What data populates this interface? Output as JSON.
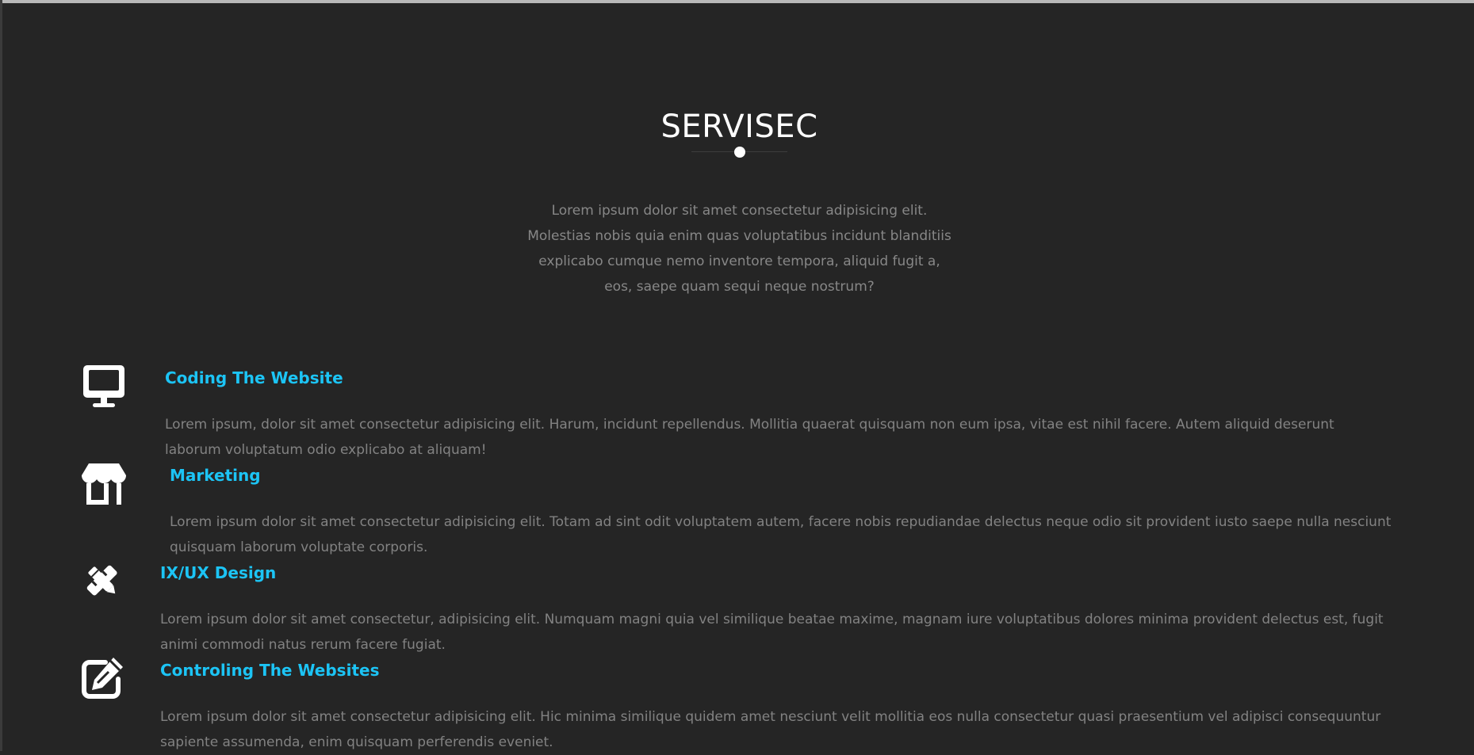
{
  "section": {
    "title": "SERVISEC",
    "intro": "Lorem ipsum dolor sit amet consectetur adipisicing elit. Molestias nobis quia enim quas voluptatibus incidunt blanditiis explicabo cumque nemo inventore tempora, aliquid fugit a, eos, saepe quam sequi neque nostrum?"
  },
  "services": [
    {
      "icon": "desktop-icon",
      "title": "Coding The Website",
      "desc": "Lorem ipsum, dolor sit amet consectetur adipisicing elit. Harum, incidunt repellendus. Mollitia quaerat quisquam non eum ipsa, vitae est nihil facere. Autem aliquid deserunt laborum voluptatum odio explicabo at aliquam!"
    },
    {
      "icon": "shop-icon",
      "title": "Marketing",
      "desc": "Lorem ipsum dolor sit amet consectetur adipisicing elit. Totam ad sint odit voluptatem autem, facere nobis repudiandae delectus neque odio sit provident iusto saepe nulla nesciunt quisquam laborum voluptate corporis."
    },
    {
      "icon": "design-tools-icon",
      "title": "IX/UX Design",
      "desc": "Lorem ipsum dolor sit amet consectetur, adipisicing elit. Numquam magni quia vel similique beatae maxime, magnam iure voluptatibus dolores minima provident delectus est, fugit animi commodi natus rerum facere fugiat."
    },
    {
      "icon": "edit-icon",
      "title": "Controling The Websites",
      "desc": "Lorem ipsum dolor sit amet consectetur adipisicing elit. Hic minima similique quidem amet nesciunt velit mollitia eos nulla consectetur quasi praesentium vel adipisci consequuntur sapiente assumenda, enim quisquam perferendis eveniet."
    }
  ]
}
